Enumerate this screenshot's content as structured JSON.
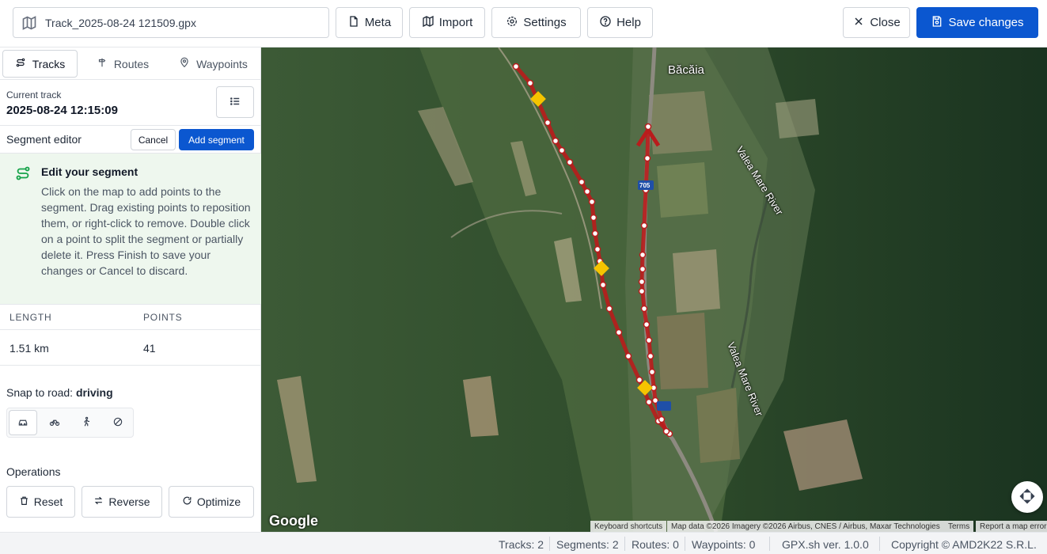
{
  "header": {
    "file_name": "Track_2025-08-24 121509.gpx",
    "meta_label": "Meta",
    "import_label": "Import",
    "settings_label": "Settings",
    "help_label": "Help",
    "close_label": "Close",
    "save_label": "Save changes",
    "save_color": "#0b57d0"
  },
  "tabs": [
    {
      "label": "Tracks",
      "icon": "route-icon",
      "active": true
    },
    {
      "label": "Routes",
      "icon": "signpost-icon",
      "active": false
    },
    {
      "label": "Waypoints",
      "icon": "map-pin-icon",
      "active": false
    }
  ],
  "current_track": {
    "label": "Current track",
    "value": "2025-08-24 12:15:09"
  },
  "segment_editor": {
    "title": "Segment editor",
    "cancel_label": "Cancel",
    "add_label": "Add segment"
  },
  "info": {
    "title": "Edit your segment",
    "body": "Click on the map to add points to the segment. Drag existing points to reposition them, or right-click to remove. Double click on a point to split the segment or partially delete it. Press Finish to save your changes or Cancel to discard.",
    "bg_color": "#eef7ee"
  },
  "stats": {
    "length_header": "LENGTH",
    "points_header": "POINTS",
    "length_value": "1.51 km",
    "points_value": "41"
  },
  "snap": {
    "label": "Snap to road:",
    "mode": "driving",
    "options": [
      "car-icon",
      "bike-icon",
      "walk-icon",
      "none-icon"
    ]
  },
  "operations": {
    "label": "Operations",
    "reset_label": "Reset",
    "reverse_label": "Reverse",
    "optimize_label": "Optimize"
  },
  "map": {
    "place_label": "Băcăia",
    "river_label_1": "Valea Mare River",
    "river_label_2": "Valea Mare River",
    "road_shield": "705",
    "google_logo": "Google",
    "attrib_shortcuts": "Keyboard shortcuts",
    "attrib_data": "Map data ©2026 Imagery ©2026 Airbus, CNES / Airbus, Maxar Technologies",
    "attrib_terms": "Terms",
    "attrib_report": "Report a map error",
    "track_color": "#b91c1c"
  },
  "status": {
    "tracks": "Tracks: 2",
    "segments": "Segments: 2",
    "routes": "Routes: 0",
    "waypoints": "Waypoints: 0",
    "version": "GPX.sh ver. 1.0.0",
    "copyright": "Copyright © AMD2K22 S.R.L."
  }
}
